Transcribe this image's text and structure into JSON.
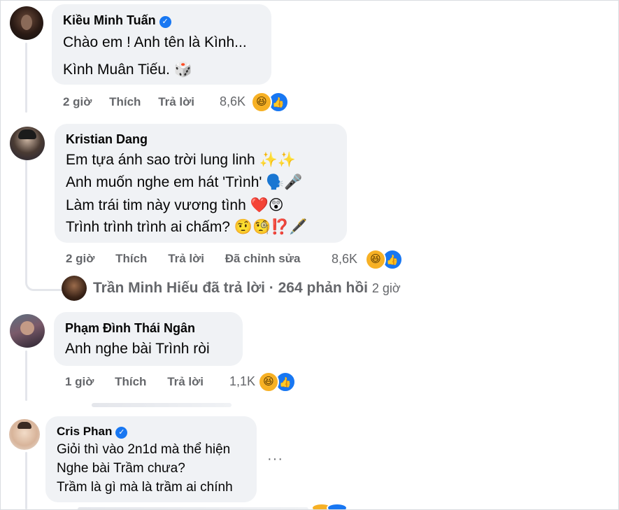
{
  "comments": [
    {
      "author": "Kiều Minh Tuấn",
      "verified": true,
      "lines": [
        "Chào em ! Anh tên là Kình...",
        "Kình Muân Tiếu. 🎲"
      ],
      "time": "2 giờ",
      "like_label": "Thích",
      "reply_label": "Trả lời",
      "reaction_count": "8,6K",
      "reactions": [
        "haha",
        "like"
      ]
    },
    {
      "author": "Kristian Dang",
      "verified": false,
      "lines": [
        "Em tựa ánh sao trời lung linh ✨✨",
        "Anh muốn nghe em hát 'Trình' 🗣️🎤",
        "Làm trái tim này vương tình ❤️😲",
        "Trình trình trình ai chấm? 🤨🧐⁉️🖋️"
      ],
      "time": "2 giờ",
      "like_label": "Thích",
      "reply_label": "Trả lời",
      "edited_label": "Đã chỉnh sửa",
      "reaction_count": "8,6K",
      "reactions": [
        "haha",
        "like"
      ],
      "reply_summary": {
        "text": "Trần Minh Hiếu đã trả lời · 264 phản hồi",
        "time": "2 giờ"
      }
    },
    {
      "author": "Phạm Đình Thái Ngân",
      "verified": false,
      "lines": [
        "Anh nghe bài Trình ròi"
      ],
      "time": "1 giờ",
      "like_label": "Thích",
      "reply_label": "Trả lời",
      "reaction_count": "1,1K",
      "reactions": [
        "haha",
        "like"
      ]
    },
    {
      "author": "Cris Phan",
      "verified": true,
      "lines": [
        "Giỏi thì vào 2n1d mà thể hiện",
        "Nghe bài Trầm chưa?",
        "Trầm là gì mà là trầm ai chính"
      ],
      "more_label": "···"
    }
  ],
  "icons": {
    "verified": "verified-badge-icon",
    "haha": "haha-reaction-icon",
    "like": "like-reaction-icon",
    "more": "more-options-icon"
  },
  "colors": {
    "bubble": "#f0f2f5",
    "secondary_text": "#65676b",
    "verified": "#1877f2",
    "haha": "#f7b125",
    "like": "#1877f2"
  }
}
